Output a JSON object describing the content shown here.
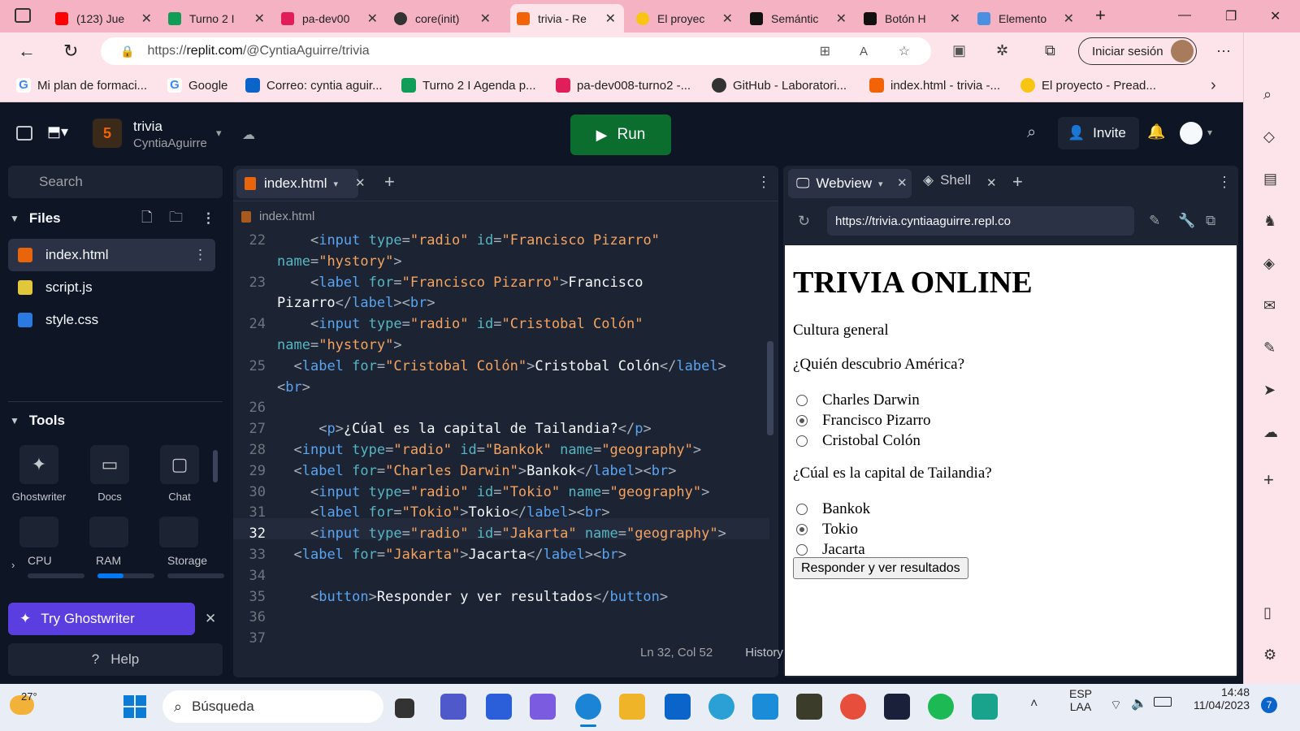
{
  "browser": {
    "tabs": [
      {
        "title": "(123) Jue"
      },
      {
        "title": "Turno 2 I"
      },
      {
        "title": "pa-dev00"
      },
      {
        "title": "core(init)"
      },
      {
        "title": "trivia - Re"
      },
      {
        "title": "El proyec"
      },
      {
        "title": "Semántic"
      },
      {
        "title": "Botón H"
      },
      {
        "title": "Elemento"
      }
    ],
    "url_prefix": "https://",
    "url_domain": "replit.com",
    "url_path": "/@CyntiaAguirre/trivia",
    "signin_label": "Iniciar sesión",
    "bookmarks": [
      {
        "label": "Mi plan de formaci..."
      },
      {
        "label": "Google"
      },
      {
        "label": "Correo: cyntia aguir..."
      },
      {
        "label": "Turno 2 I Agenda p..."
      },
      {
        "label": "pa-dev008-turno2 -..."
      },
      {
        "label": "GitHub - Laboratori..."
      },
      {
        "label": "index.html - trivia -..."
      },
      {
        "label": "El proyecto - Pread..."
      }
    ]
  },
  "replit": {
    "repl_name": "trivia",
    "repl_owner": "CyntiaAguirre",
    "run_label": "Run",
    "invite_label": "Invite",
    "search_placeholder": "Search",
    "files_header": "Files",
    "files": [
      {
        "name": "index.html"
      },
      {
        "name": "script.js"
      },
      {
        "name": "style.css"
      }
    ],
    "tools_header": "Tools",
    "tools": [
      {
        "label": "Ghostwriter"
      },
      {
        "label": "Docs"
      },
      {
        "label": "Chat"
      }
    ],
    "resources": {
      "cpu_label": "CPU",
      "ram_label": "RAM",
      "storage_label": "Storage",
      "cpu_level": 0.0,
      "ram_level": 0.45,
      "storage_level": 0.0
    },
    "ghostwriter_label": "Try Ghostwriter",
    "help_label": "Help",
    "editor": {
      "tab_label": "index.html",
      "breadcrumb": "index.html",
      "status_position": "Ln 32, Col 52",
      "history_label": "History",
      "line_numbers": [
        "22",
        "",
        "23",
        "",
        "24",
        "",
        "25",
        "",
        "26",
        "27",
        "28",
        "29",
        "30",
        "31",
        "32",
        "33",
        "34",
        "35",
        "36",
        "37"
      ]
    },
    "webview": {
      "tab_label": "Webview",
      "shell_label": "Shell",
      "url": "https://trivia.cyntiaaguirre.repl.co",
      "page": {
        "title": "TRIVIA ONLINE",
        "subtitle": "Cultura general",
        "q1": "¿Quién descubrio América?",
        "q1_options": [
          "Charles Darwin",
          "Francisco Pizarro",
          "Cristobal Colón"
        ],
        "q1_selected": 1,
        "q2": "¿Cúal es la capital de Tailandia?",
        "q2_options": [
          "Bankok",
          "Tokio",
          "Jacarta"
        ],
        "q2_selected": 1,
        "button": "Responder y ver resultados"
      }
    }
  },
  "taskbar": {
    "weather_temp": "27°",
    "search_label": "Búsqueda",
    "lang_1": "ESP",
    "lang_2": "LAA",
    "time": "14:48",
    "date": "11/04/2023",
    "notif_count": "7"
  },
  "colors": {
    "chrome": "#f5b2c2",
    "replit_bg": "#0e1525",
    "run_green": "#0b6e2e",
    "ghostwriter": "#5b3ee0"
  }
}
